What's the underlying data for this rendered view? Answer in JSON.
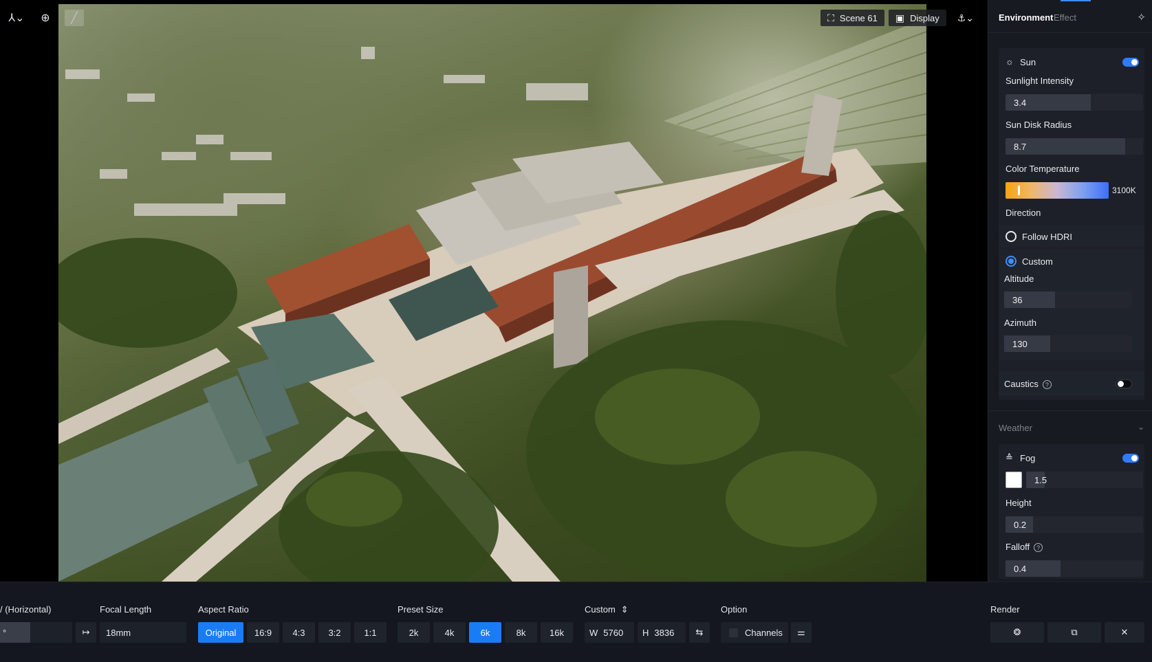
{
  "viewport": {
    "toolbar_left": [
      {
        "icon": "axis-gizmo-icon",
        "glyph": "⅄⌄"
      },
      {
        "icon": "globe-icon",
        "glyph": "⊕"
      },
      {
        "icon": "brush-icon",
        "glyph": "╱"
      }
    ],
    "scene_label": "Scene 61",
    "display_label": "Display",
    "scene_icon": "screenshot-frame-icon",
    "display_icon": "display-icon",
    "camera_icon": "camera-move-icon"
  },
  "panel": {
    "tabs": [
      "Environment",
      "Effect"
    ],
    "active_tab": "Environment",
    "sun": {
      "title": "Sun",
      "enabled": true,
      "sunlight_intensity_label": "Sunlight Intensity",
      "sunlight_intensity": "3.4",
      "sunlight_intensity_level": 0.62,
      "sun_disk_radius_label": "Sun Disk Radius",
      "sun_disk_radius": "8.7",
      "sun_disk_radius_level": 0.87,
      "color_temperature_label": "Color Temperature",
      "color_temperature": "3100K",
      "direction_label": "Direction",
      "direction_options": [
        "Follow HDRI",
        "Custom"
      ],
      "direction_selected": "Custom",
      "altitude_label": "Altitude",
      "altitude": "36",
      "altitude_level": 0.4,
      "azimuth_label": "Azimuth",
      "azimuth": "130",
      "azimuth_level": 0.36,
      "caustics_label": "Caustics",
      "caustics_enabled": false
    },
    "weather": {
      "title": "Weather",
      "fog_title": "Fog",
      "fog_enabled": true,
      "fog_color": "#ffffff",
      "fog_density": "1.5",
      "fog_density_level": 0.16,
      "height_label": "Height",
      "height": "0.2",
      "height_level": 0.2,
      "falloff_label": "Falloff",
      "falloff": "0.4",
      "falloff_level": 0.4
    }
  },
  "bottom": {
    "fov_label": "/ (Horizontal)",
    "fov_value": "°",
    "focal_length_label": "Focal Length",
    "focal_length": "18mm",
    "aspect_ratio_label": "Aspect Ratio",
    "aspect_ratios": [
      "Original",
      "16:9",
      "4:3",
      "3:2",
      "1:1"
    ],
    "aspect_ratio_selected": "Original",
    "preset_size_label": "Preset Size",
    "preset_sizes": [
      "2k",
      "4k",
      "6k",
      "8k",
      "16k"
    ],
    "preset_size_selected": "6k",
    "custom_label": "Custom",
    "width_prefix": "W",
    "width": "5760",
    "height_prefix": "H",
    "height": "3836",
    "option_label": "Option",
    "channels_label": "Channels",
    "render_label": "Render"
  },
  "colors": {
    "accent": "#1a7cf5",
    "panel_bg": "#171a21",
    "bottom_bg": "#141720"
  }
}
